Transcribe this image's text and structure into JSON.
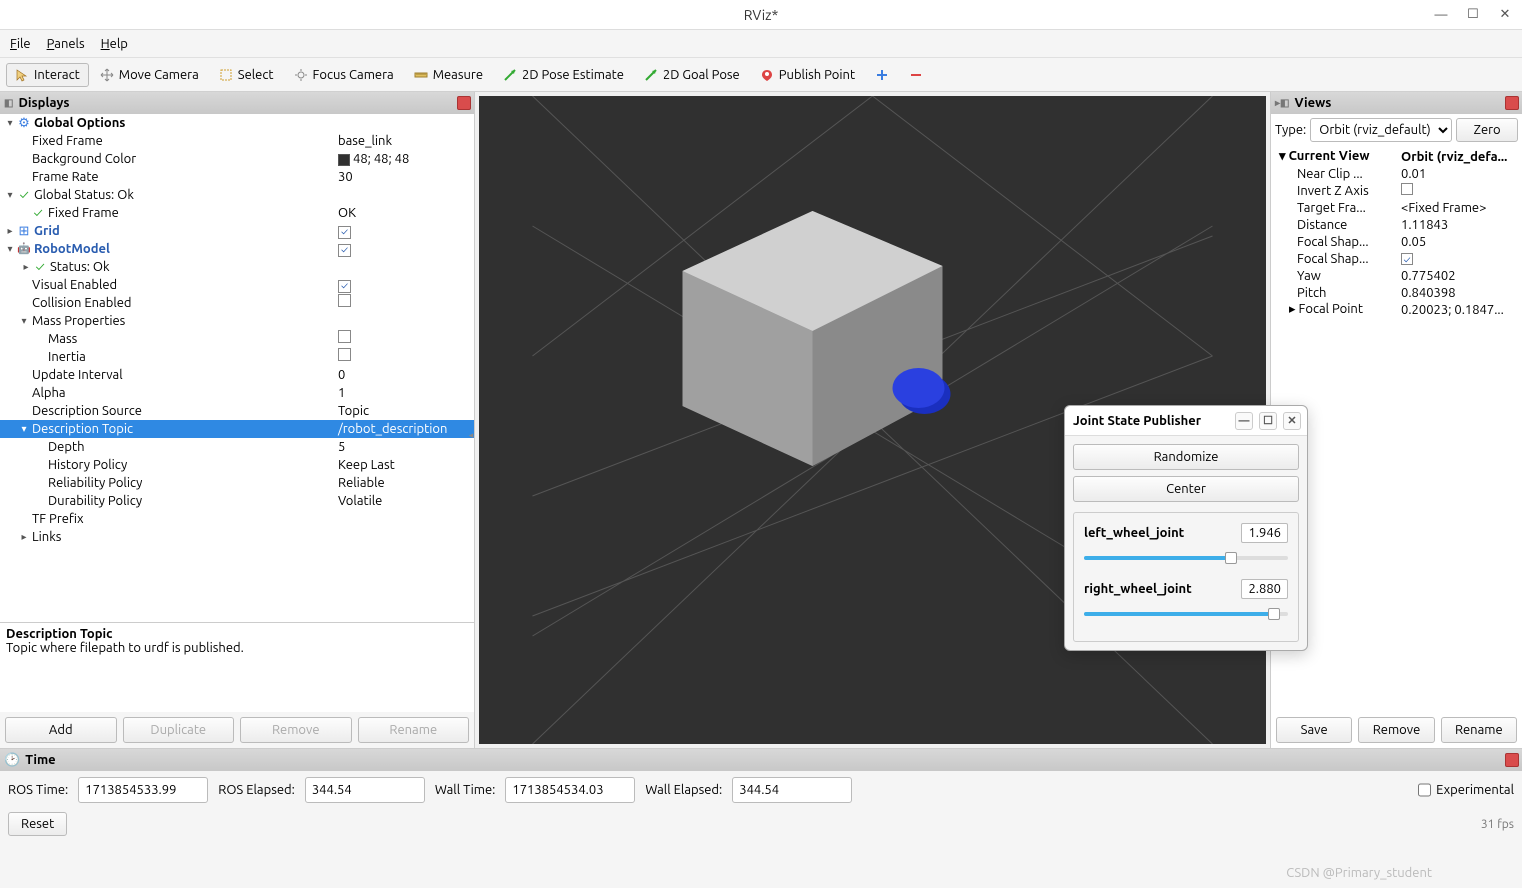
{
  "window": {
    "title": "RViz*"
  },
  "menu": {
    "file": "File",
    "panels": "Panels",
    "help": "Help"
  },
  "toolbar": {
    "interact": "Interact",
    "move_camera": "Move Camera",
    "select": "Select",
    "focus_camera": "Focus Camera",
    "measure": "Measure",
    "pose_estimate": "2D Pose Estimate",
    "goal_pose": "2D Goal Pose",
    "publish_point": "Publish Point"
  },
  "displays": {
    "title": "Displays",
    "global_options": "Global Options",
    "fixed_frame": {
      "label": "Fixed Frame",
      "value": "base_link"
    },
    "background_color": {
      "label": "Background Color",
      "value": "48; 48; 48"
    },
    "frame_rate": {
      "label": "Frame Rate",
      "value": "30"
    },
    "global_status": "Global Status: Ok",
    "fixed_frame_status": {
      "label": "Fixed Frame",
      "value": "OK"
    },
    "grid": "Grid",
    "robot_model": "RobotModel",
    "status_ok": "Status: Ok",
    "visual_enabled": "Visual Enabled",
    "collision_enabled": "Collision Enabled",
    "mass_properties": "Mass Properties",
    "mass": "Mass",
    "inertia": "Inertia",
    "update_interval": {
      "label": "Update Interval",
      "value": "0"
    },
    "alpha": {
      "label": "Alpha",
      "value": "1"
    },
    "description_source": {
      "label": "Description Source",
      "value": "Topic"
    },
    "description_topic": {
      "label": "Description Topic",
      "value": "/robot_description"
    },
    "depth": {
      "label": "Depth",
      "value": "5"
    },
    "history_policy": {
      "label": "History Policy",
      "value": "Keep Last"
    },
    "reliability_policy": {
      "label": "Reliability Policy",
      "value": "Reliable"
    },
    "durability_policy": {
      "label": "Durability Policy",
      "value": "Volatile"
    },
    "tf_prefix": "TF Prefix",
    "links": "Links",
    "desc_title": "Description Topic",
    "desc_body": "Topic where filepath to urdf is published.",
    "add": "Add",
    "duplicate": "Duplicate",
    "remove": "Remove",
    "rename": "Rename"
  },
  "views": {
    "title": "Views",
    "type_label": "Type:",
    "type_value": "Orbit (rviz_default)",
    "zero": "Zero",
    "current_view": {
      "label": "Current View",
      "value": "Orbit (rviz_defa..."
    },
    "near_clip": {
      "label": "Near Clip ...",
      "value": "0.01"
    },
    "invert_z": "Invert Z Axis",
    "target_frame": {
      "label": "Target Fra...",
      "value": "<Fixed Frame>"
    },
    "distance": {
      "label": "Distance",
      "value": "1.11843"
    },
    "focal_shape_size": {
      "label": "Focal Shap...",
      "value": "0.05"
    },
    "focal_shape_fixed": "Focal Shap...",
    "yaw": {
      "label": "Yaw",
      "value": "0.775402"
    },
    "pitch": {
      "label": "Pitch",
      "value": "0.840398"
    },
    "focal_point": {
      "label": "Focal Point",
      "value": "0.20023; 0.1847..."
    },
    "save": "Save",
    "remove_btn": "Remove",
    "rename": "Rename"
  },
  "jsp": {
    "title": "Joint State Publisher",
    "randomize": "Randomize",
    "center": "Center",
    "left": {
      "label": "left_wheel_joint",
      "value": "1.946",
      "pct": 72
    },
    "right": {
      "label": "right_wheel_joint",
      "value": "2.880",
      "pct": 93
    }
  },
  "time": {
    "title": "Time",
    "ros_time": {
      "label": "ROS Time:",
      "value": "1713854533.99"
    },
    "ros_elapsed": {
      "label": "ROS Elapsed:",
      "value": "344.54"
    },
    "wall_time": {
      "label": "Wall Time:",
      "value": "1713854534.03"
    },
    "wall_elapsed": {
      "label": "Wall Elapsed:",
      "value": "344.54"
    },
    "experimental": "Experimental",
    "reset": "Reset",
    "fps": "31 fps"
  },
  "watermark": "CSDN @Primary_student"
}
